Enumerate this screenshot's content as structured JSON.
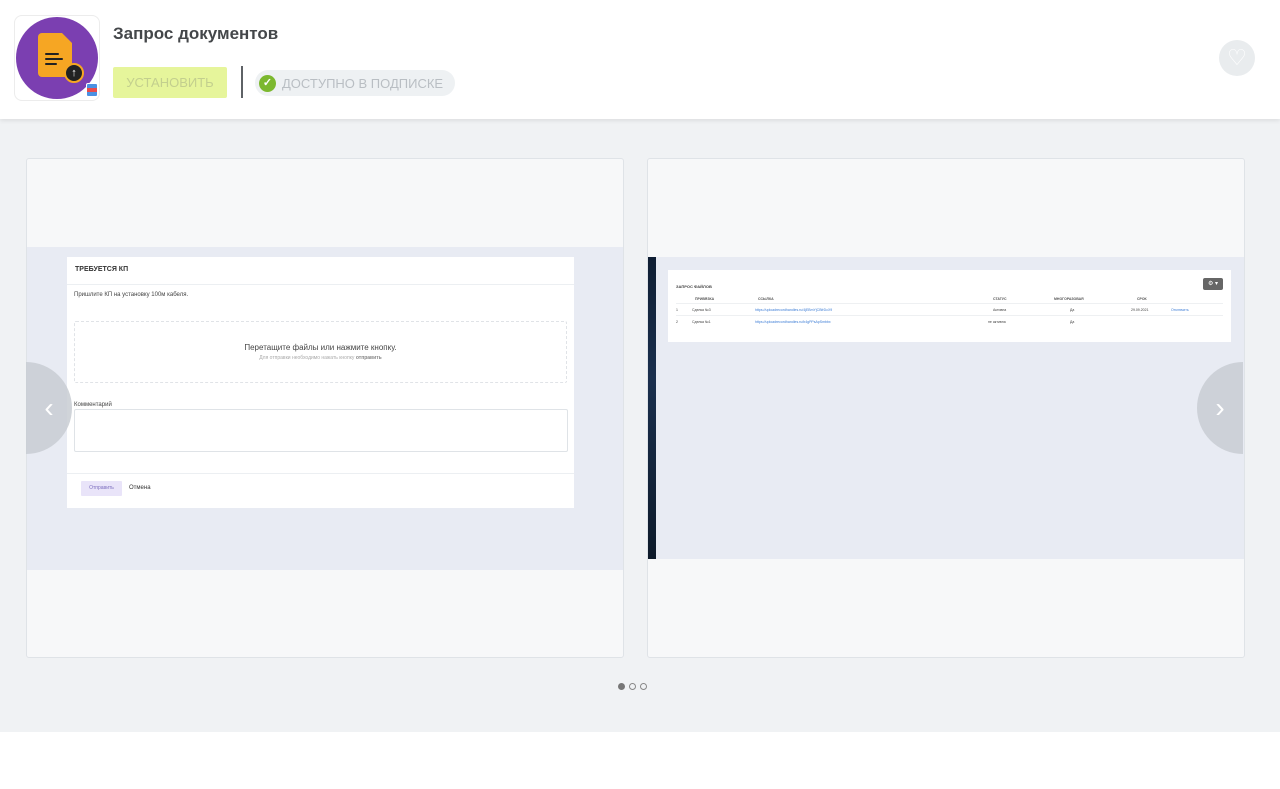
{
  "app": {
    "title": "Запрос документов",
    "install_label": "УСТАНОВИТЬ",
    "subscription_label": "ДОСТУПНО В ПОДПИСКЕ"
  },
  "colors": {
    "icon_bg": "#7b3fb1",
    "doc": "#f6a623",
    "install_bg": "#e6f59b",
    "check": "#7cb82f"
  },
  "icons": {
    "heart": "heart-icon",
    "check": "check-icon",
    "prev": "chevron-left-icon",
    "next": "chevron-right-icon"
  },
  "slide1": {
    "form_title": "ТРЕБУЕТСЯ КП",
    "request_text": "Пришлите КП на установку 100м кабеля.",
    "drop_main": "Перетащите файлы или нажмите кнопку.",
    "drop_hint": "Для отправки необходимо нажать кнопку",
    "drop_hint_bold": "отправить",
    "comment_label": "Комментарий",
    "send_label": "Отправить",
    "cancel_label": "Отмена"
  },
  "slide2": {
    "table_title": "ЗАПРОС ФАЙЛОВ",
    "headers": [
      "ПРИВЯЗКА",
      "ССЫЛКА",
      "СТАТУС",
      "МНОГОРАЗОВАЯ",
      "СРОК"
    ],
    "rows": [
      {
        "n": "1",
        "binding": "Сделка №3",
        "link": "https://uploadrecordhandles.ru/4jEBmYjCBfrDcX9",
        "status": "Активна",
        "reusable": "Да",
        "date": "29.09.2021",
        "action": "Отключить"
      },
      {
        "n": "2",
        "binding": "Сделка №1",
        "link": "https://uploadrecordhandles.ru/b4gPPsApSmbbx",
        "status": "не активна",
        "reusable": "Да",
        "date": "",
        "action": ""
      }
    ]
  },
  "carousel": {
    "slide_count": 3,
    "active_index": 0
  }
}
